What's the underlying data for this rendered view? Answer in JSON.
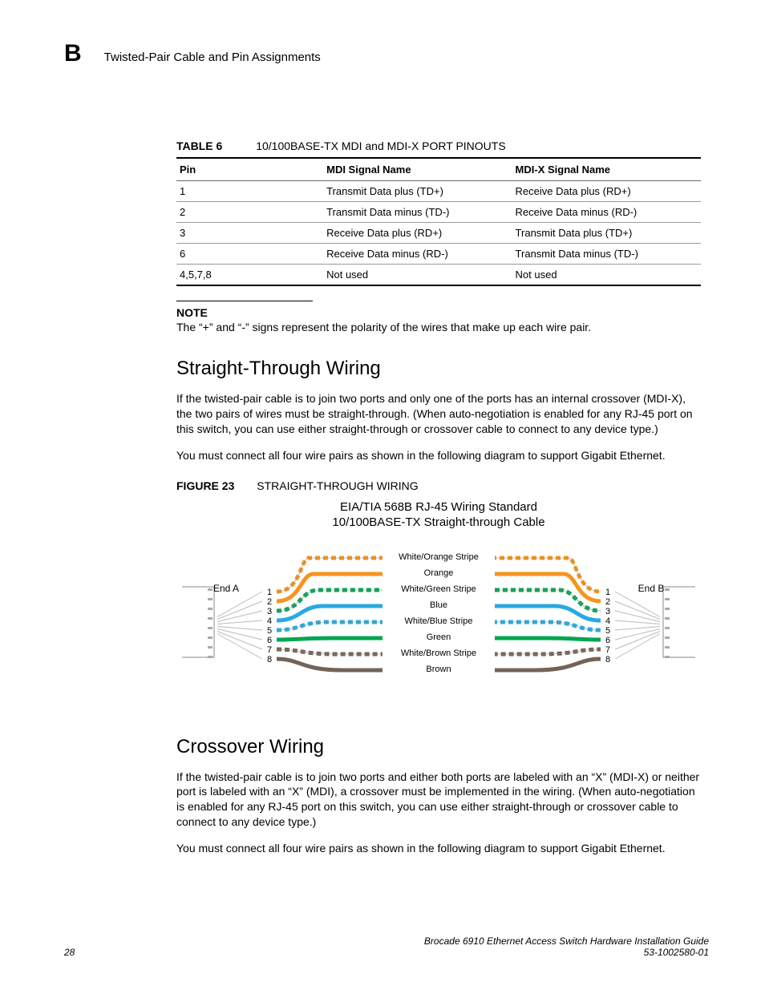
{
  "header": {
    "appendix_letter": "B",
    "title": "Twisted-Pair Cable and Pin Assignments"
  },
  "table6": {
    "label": "TABLE 6",
    "caption": "10/100BASE-TX MDI and MDI-X PORT PINOUTS",
    "columns": [
      "Pin",
      "MDI Signal Name",
      "MDI-X Signal Name"
    ],
    "rows": [
      [
        "1",
        "Transmit Data plus (TD+)",
        "Receive Data plus (RD+)"
      ],
      [
        "2",
        "Transmit Data minus (TD-)",
        "Receive Data minus (RD-)"
      ],
      [
        "3",
        "Receive Data plus (RD+)",
        "Transmit Data plus (TD+)"
      ],
      [
        "6",
        "Receive Data minus (RD-)",
        "Transmit Data minus (TD-)"
      ],
      [
        "4,5,7,8",
        "Not used",
        "Not used"
      ]
    ]
  },
  "note": {
    "label": "NOTE",
    "text": "The “+” and “-” signs represent the polarity of the wires that make up each wire pair."
  },
  "section1": {
    "heading": "Straight-Through Wiring",
    "para1": "If the twisted-pair cable is to join two ports and only one of the ports has an internal crossover (MDI-X), the two pairs of wires must be straight-through. (When auto-negotiation is enabled for any RJ-45 port on this switch, you can use either straight-through or crossover cable to connect to any device type.)",
    "para2": "You must connect all four wire pairs as shown in the following diagram to support Gigabit Ethernet."
  },
  "figure23": {
    "label": "FIGURE 23",
    "caption": "STRAIGHT-THROUGH WIRING",
    "title": "EIA/TIA 568B RJ-45 Wiring Standard",
    "subtitle": "10/100BASE-TX Straight-through Cable",
    "end_a": "End A",
    "end_b": "End B",
    "wires": [
      {
        "label": "White/Orange Stripe",
        "color": "#f7941d",
        "stripe": true
      },
      {
        "label": "Orange",
        "color": "#f7941d",
        "stripe": false
      },
      {
        "label": "White/Green Stripe",
        "color": "#00a651",
        "stripe": true
      },
      {
        "label": "Blue",
        "color": "#27aae1",
        "stripe": false
      },
      {
        "label": "White/Blue Stripe",
        "color": "#27aae1",
        "stripe": true
      },
      {
        "label": "Green",
        "color": "#00a651",
        "stripe": false
      },
      {
        "label": "White/Brown Stripe",
        "color": "#736357",
        "stripe": true
      },
      {
        "label": "Brown",
        "color": "#736357",
        "stripe": false
      }
    ],
    "pins": [
      "1",
      "2",
      "3",
      "4",
      "5",
      "6",
      "7",
      "8"
    ]
  },
  "section2": {
    "heading": "Crossover Wiring",
    "para1": "If the twisted-pair cable is to join two ports and either both ports are labeled with an “X” (MDI-X) or neither port is labeled with an “X” (MDI), a crossover must be implemented in the wiring. (When auto-negotiation is enabled for any RJ-45 port on this switch, you can use either straight-through or crossover cable to connect to any device type.)",
    "para2": "You must connect all four wire pairs as shown in the following diagram to support Gigabit Ethernet."
  },
  "footer": {
    "page": "28",
    "book": "Brocade 6910 Ethernet Access Switch Hardware Installation Guide",
    "docnum": "53-1002580-01"
  }
}
